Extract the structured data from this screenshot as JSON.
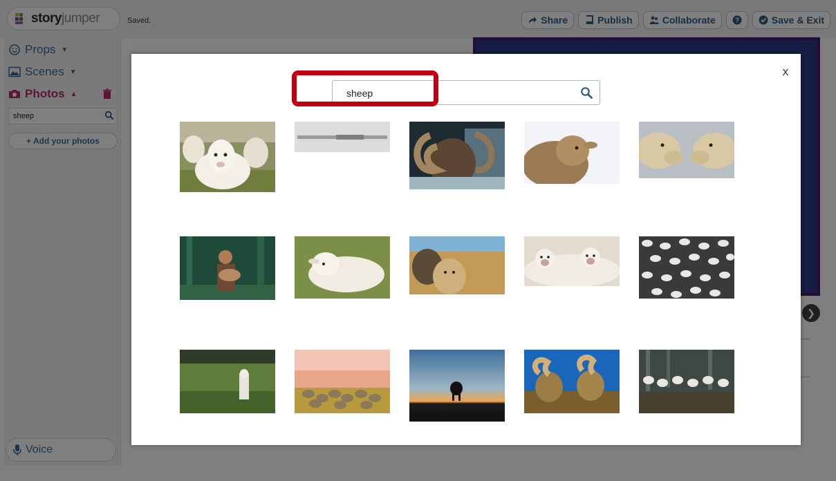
{
  "header": {
    "logo_text_bold": "story",
    "logo_text_thin": "jumper",
    "status": "Saved.",
    "buttons": [
      {
        "label": "Share",
        "icon": "share-arrow-icon"
      },
      {
        "label": "Publish",
        "icon": "book-icon"
      },
      {
        "label": "Collaborate",
        "icon": "people-icon"
      },
      {
        "label": "",
        "icon": "help-icon"
      },
      {
        "label": "Save & Exit",
        "icon": "check-circle-icon"
      }
    ]
  },
  "sidebar": {
    "props_label": "Props",
    "scenes_label": "Scenes",
    "photos_label": "Photos",
    "search_value": "sheep",
    "add_photos_label": "+ Add your photos",
    "voice_label": "Voice"
  },
  "modal": {
    "close_label": "x",
    "search_value": "sheep",
    "search_icon": "magnifier-icon",
    "results": [
      "sheep-flock-closeup",
      "caption-strip",
      "mouflon-ram",
      "sheep-portrait",
      "two-sheep-facing",
      "boy-holding-lamb",
      "lamb-lying-grass",
      "two-sheep-field",
      "sheep-pair-white",
      "flock-black-white",
      "lamb-in-tall-grass",
      "flock-pink-field",
      "sheep-sunset-silhouette",
      "bighorn-rams",
      "flock-forest-edge"
    ]
  },
  "colors": {
    "highlight": "#c00012",
    "link_blue": "#3b6a96",
    "photos_magenta": "#b0306a"
  }
}
